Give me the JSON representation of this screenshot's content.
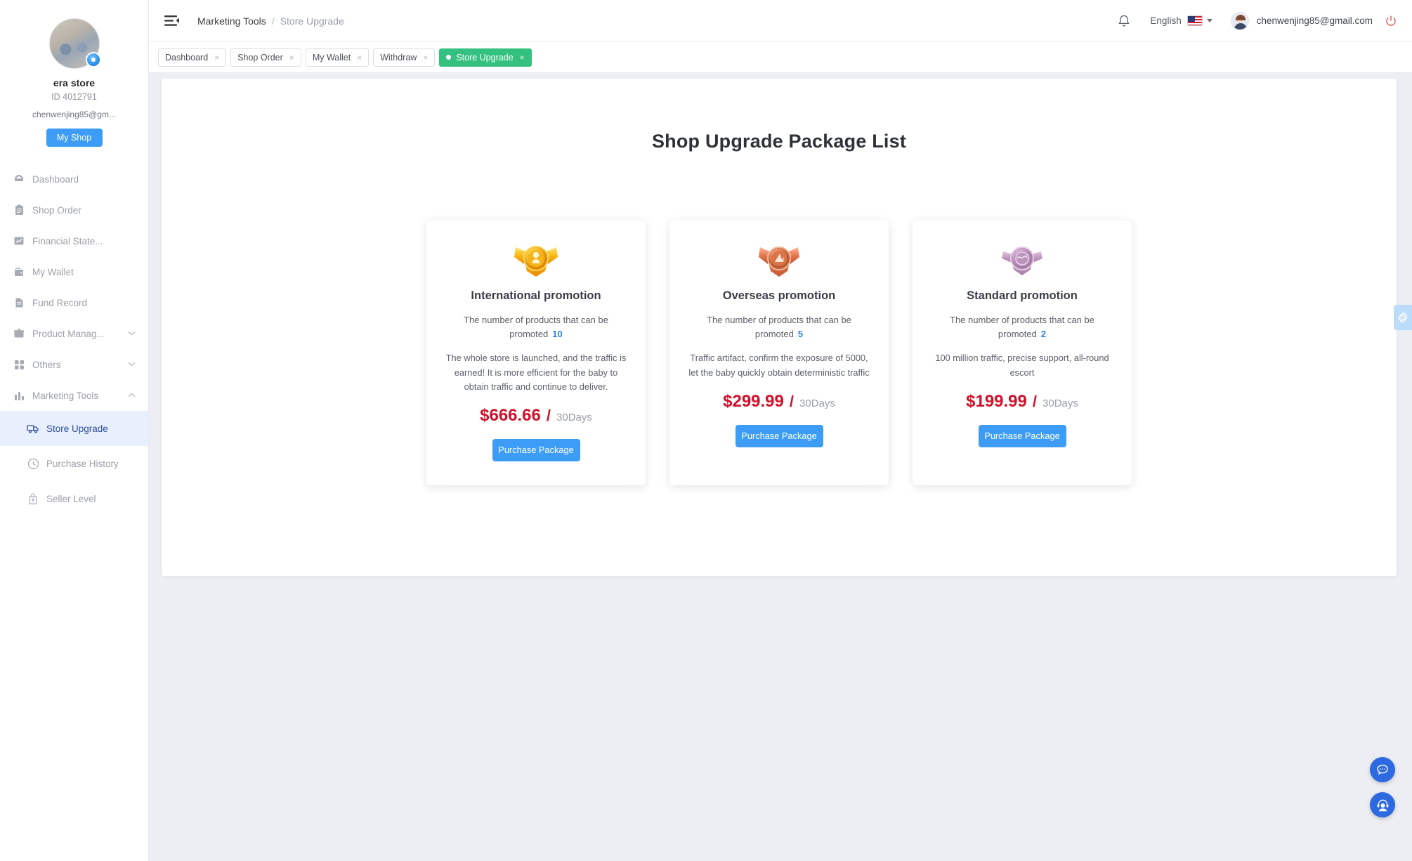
{
  "sidebar": {
    "store_name": "era store",
    "store_id": "ID 4012791",
    "store_email": "chenwenjing85@gm...",
    "my_shop_label": "My Shop",
    "items": [
      {
        "label": "Dashboard",
        "icon": "dashboard-icon",
        "expandable": false
      },
      {
        "label": "Shop Order",
        "icon": "clipboard-icon",
        "expandable": false
      },
      {
        "label": "Financial State...",
        "icon": "chart-icon",
        "expandable": false
      },
      {
        "label": "My Wallet",
        "icon": "wallet-icon",
        "expandable": false
      },
      {
        "label": "Fund Record",
        "icon": "document-icon",
        "expandable": false
      },
      {
        "label": "Product Manag...",
        "icon": "box-icon",
        "expandable": true
      },
      {
        "label": "Others",
        "icon": "grid-icon",
        "expandable": true
      },
      {
        "label": "Marketing Tools",
        "icon": "bar-chart-icon",
        "expandable": true
      }
    ],
    "sub_items": [
      {
        "label": "Store Upgrade",
        "icon": "truck-icon",
        "active": true
      },
      {
        "label": "Purchase History",
        "icon": "clock-icon",
        "active": false
      },
      {
        "label": "Seller Level",
        "icon": "bag-up-icon",
        "active": false
      }
    ]
  },
  "header": {
    "breadcrumb_parent": "Marketing Tools",
    "breadcrumb_separator": "/",
    "breadcrumb_current": "Store Upgrade",
    "language": "English",
    "user_email": "chenwenjing85@gmail.com"
  },
  "tabs": [
    {
      "label": "Dashboard",
      "close": "×",
      "active": false
    },
    {
      "label": "Shop Order",
      "close": "×",
      "active": false
    },
    {
      "label": "My Wallet",
      "close": "×",
      "active": false
    },
    {
      "label": "Withdraw",
      "close": "×",
      "active": false
    },
    {
      "label": "Store Upgrade",
      "close": "×",
      "active": true
    }
  ],
  "main": {
    "page_title": "Shop Upgrade Package List",
    "packages": [
      {
        "name": "International promotion",
        "medal": "gold-medal-icon",
        "count_label": "The number of products that can be promoted",
        "count_value": "10",
        "description": "The whole store is launched, and the traffic is earned! It is more efficient for the baby to obtain traffic and continue to deliver.",
        "price": "$666.66",
        "separator": "/",
        "period": "30Days",
        "buy_label": "Purchase Package"
      },
      {
        "name": "Overseas promotion",
        "medal": "bronze-medal-icon",
        "count_label": "The number of products that can be promoted",
        "count_value": "5",
        "description": "Traffic artifact, confirm the exposure of 5000, let the baby quickly obtain deterministic traffic",
        "price": "$299.99",
        "separator": "/",
        "period": "30Days",
        "buy_label": "Purchase Package"
      },
      {
        "name": "Standard promotion",
        "medal": "silver-medal-icon",
        "count_label": "The number of products that can be promoted",
        "count_value": "2",
        "description": "100 million traffic, precise support, all-round escort",
        "price": "$199.99",
        "separator": "/",
        "period": "30Days",
        "buy_label": "Purchase Package"
      }
    ]
  },
  "colors": {
    "accent_blue": "#3d9df6",
    "active_tab_green": "#34c180",
    "price_red": "#d0112b",
    "count_blue": "#2d7de0",
    "sidebar_active_bg": "#e8f0fd",
    "page_bg": "#eceef3"
  }
}
